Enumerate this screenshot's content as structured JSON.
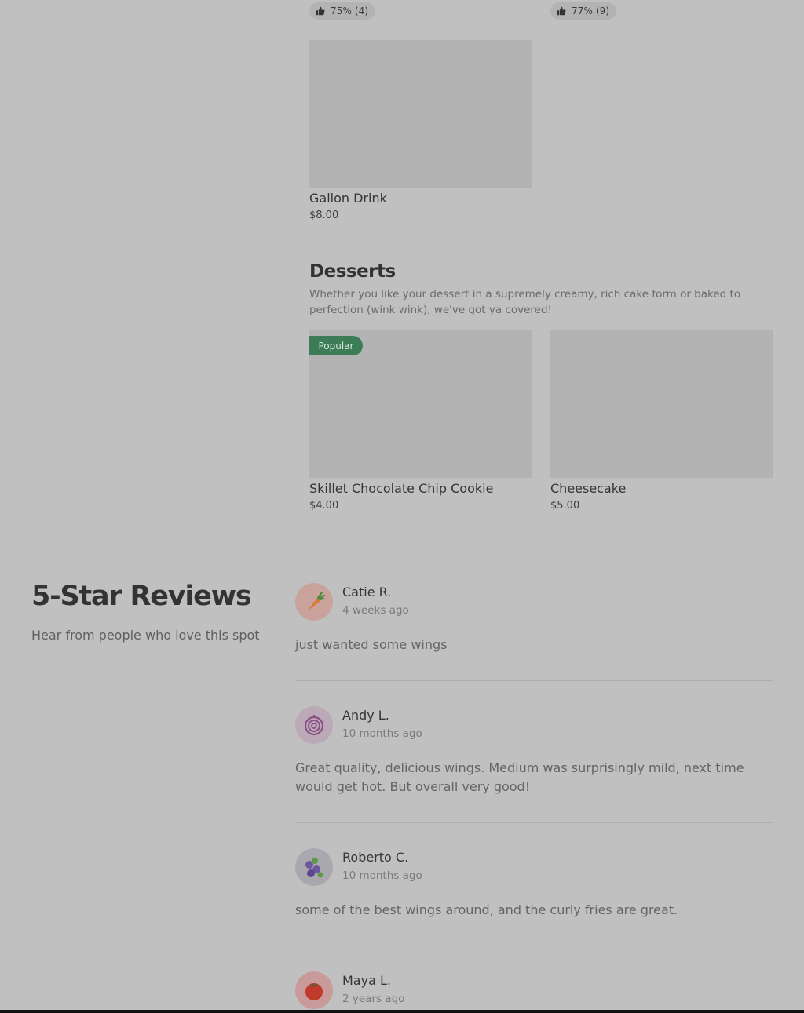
{
  "top_ratings": [
    {
      "label": "75% (4)"
    },
    {
      "label": "77% (9)"
    }
  ],
  "drinks": {
    "items": [
      {
        "name": "Gallon Drink",
        "price": "$8.00"
      }
    ]
  },
  "desserts": {
    "title": "Desserts",
    "description": "Whether you like your dessert in a supremely creamy, rich cake form or baked to perfection (wink wink), we've got ya covered!",
    "popular_badge": "Popular",
    "items": [
      {
        "name": "Skillet Chocolate Chip Cookie",
        "price": "$4.00"
      },
      {
        "name": "Cheesecake",
        "price": "$5.00"
      }
    ]
  },
  "reviews": {
    "title": "5-Star Reviews",
    "subtitle": "Hear from people who love this spot",
    "list": [
      {
        "name": "Catie R.",
        "time": "4 weeks ago",
        "text": "just wanted some wings",
        "avatar_icon": "carrot-icon",
        "avatar_bg": "#c9a39b"
      },
      {
        "name": "Andy L.",
        "time": "10 months ago",
        "text": "Great quality, delicious wings. Medium was surprisingly mild, next time would get hot. But overall very good!",
        "avatar_icon": "onion-icon",
        "avatar_bg": "#bba9b8"
      },
      {
        "name": "Roberto C.",
        "time": "10 months ago",
        "text": "some of the best wings around, and the curly fries are great.",
        "avatar_icon": "blueberry-icon",
        "avatar_bg": "#a9a8af"
      },
      {
        "name": "Maya L.",
        "time": "2 years ago",
        "text": "",
        "avatar_icon": "tomato-icon",
        "avatar_bg": "#c99a9a"
      }
    ]
  },
  "colors": {
    "background": "#c0c0c0",
    "popular_badge": "#3c7d57",
    "image_placeholder": "#b3b3b3"
  }
}
